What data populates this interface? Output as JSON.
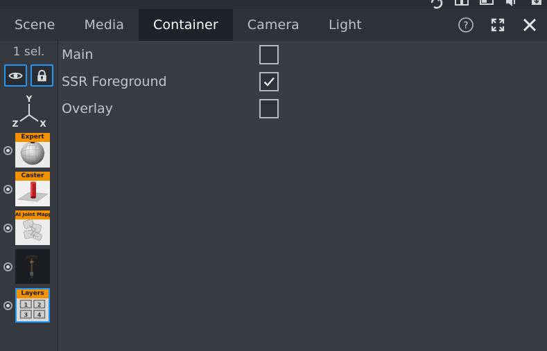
{
  "top_toolbar": {
    "icons": [
      "undo-arrow-icon",
      "book-icon",
      "presentation-icon",
      "speaker-icon",
      "download-icon"
    ]
  },
  "tabs": [
    {
      "label": "Scene",
      "active": false
    },
    {
      "label": "Media",
      "active": false
    },
    {
      "label": "Container",
      "active": true
    },
    {
      "label": "Camera",
      "active": false
    },
    {
      "label": "Light",
      "active": false
    }
  ],
  "window_tools": [
    {
      "name": "help-button",
      "icon": "question-circle-icon"
    },
    {
      "name": "fullscreen-button",
      "icon": "expand-arrows-icon"
    },
    {
      "name": "close-button",
      "icon": "close-x-icon"
    }
  ],
  "sidebar": {
    "selection_count": "1 sel.",
    "toggles": [
      {
        "name": "visibility-toggle",
        "icon": "eye-icon",
        "active": true
      },
      {
        "name": "lock-toggle",
        "icon": "lock-icon",
        "active": true
      }
    ],
    "axis_gizmo": {
      "y": "Y",
      "z": "Z",
      "x": "X"
    },
    "items": [
      {
        "label": "Expert",
        "art": "sphere",
        "selected": false,
        "has_label": true
      },
      {
        "label": "Caster",
        "art": "cylinder",
        "selected": false,
        "has_label": true
      },
      {
        "label": "AI Joint Mapper",
        "art": "joints",
        "selected": false,
        "has_label": true
      },
      {
        "label": "",
        "art": "stand",
        "selected": false,
        "has_label": false
      },
      {
        "label": "Layers",
        "art": "layers",
        "selected": true,
        "has_label": true
      }
    ],
    "layers_cells": [
      "1",
      "2",
      "3",
      "4"
    ]
  },
  "content": {
    "properties": [
      {
        "label": "Main",
        "checked": false
      },
      {
        "label": "SSR Foreground",
        "checked": true
      },
      {
        "label": "Overlay",
        "checked": false
      }
    ]
  },
  "colors": {
    "accent_blue": "#2196f3",
    "label_orange": "#f29100",
    "panel_bg": "#393c42",
    "tabbar_bg": "#2f3238",
    "active_tab_bg": "#1f2228",
    "sidebar_bg": "#36393f"
  }
}
